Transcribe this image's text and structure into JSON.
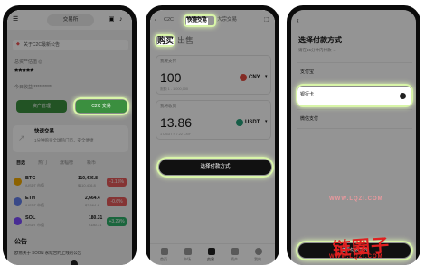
{
  "phone1": {
    "header_pill": "交易所",
    "notice": "关于C2C最新公告",
    "account_label": "总资产估值 ◎",
    "balance_masked": "*****",
    "pnl_label": "今日收益 **********",
    "btn_left": "资产管理",
    "btn_right": "C2C 交易",
    "card_title": "快速交易",
    "card_desc": "1分钟购买全球热门币，安全便捷",
    "list_tabs": [
      "自选",
      "热门",
      "涨幅榜",
      "新币"
    ],
    "coins": [
      {
        "symbol": "BTC",
        "sub": "/USDT 市值",
        "price": "110,436.8",
        "price_sub": "$110,436.8",
        "change": "-1.15%",
        "change_color": "#e55a5a"
      },
      {
        "symbol": "ETH",
        "sub": "/USDT 市值",
        "price": "2,664.4",
        "price_sub": "$2,664.4",
        "change": "-0.6%",
        "change_color": "#e55a5a"
      },
      {
        "symbol": "SOL",
        "sub": "/USDT 市值",
        "price": "180.31",
        "price_sub": "$180.31",
        "change": "+3.29%",
        "change_color": "#2db06a"
      }
    ],
    "announce_title": "公告",
    "announce_text": "欧易关于 SOON 永续合约上线的公告"
  },
  "phone2": {
    "tabs": [
      "C2C",
      "快捷交易",
      "大宗交易"
    ],
    "side_buy": "购买",
    "side_sell": "出售",
    "pay_label": "我要支付",
    "pay_value": "100",
    "pay_currency": "CNY",
    "pay_limit": "限额 1 - 1,000,000",
    "get_label": "我将收到",
    "get_value": "13.86",
    "get_currency": "USDT",
    "rate": "1 USDT ≈ 7.22 CNY",
    "action_button": "选择付款方式",
    "bottom_tabs": [
      "首页",
      "市场",
      "交易",
      "资产",
      "我的"
    ]
  },
  "phone3": {
    "title": "选择付款方式",
    "subtitle": "请在15分钟内付款 →",
    "options": [
      "支付宝",
      "银行卡",
      "微信支付"
    ],
    "selected_index": 1,
    "button": "选择付款方式",
    "watermark_main": "链圈子",
    "watermark_sub": "WWW.LQZI.COM",
    "watermark_mid": "WWW.LQZI.COM"
  },
  "colors": {
    "highlight": "#d8f5a8",
    "green_button": "#3b8f3f",
    "dark_button": "#111111"
  }
}
